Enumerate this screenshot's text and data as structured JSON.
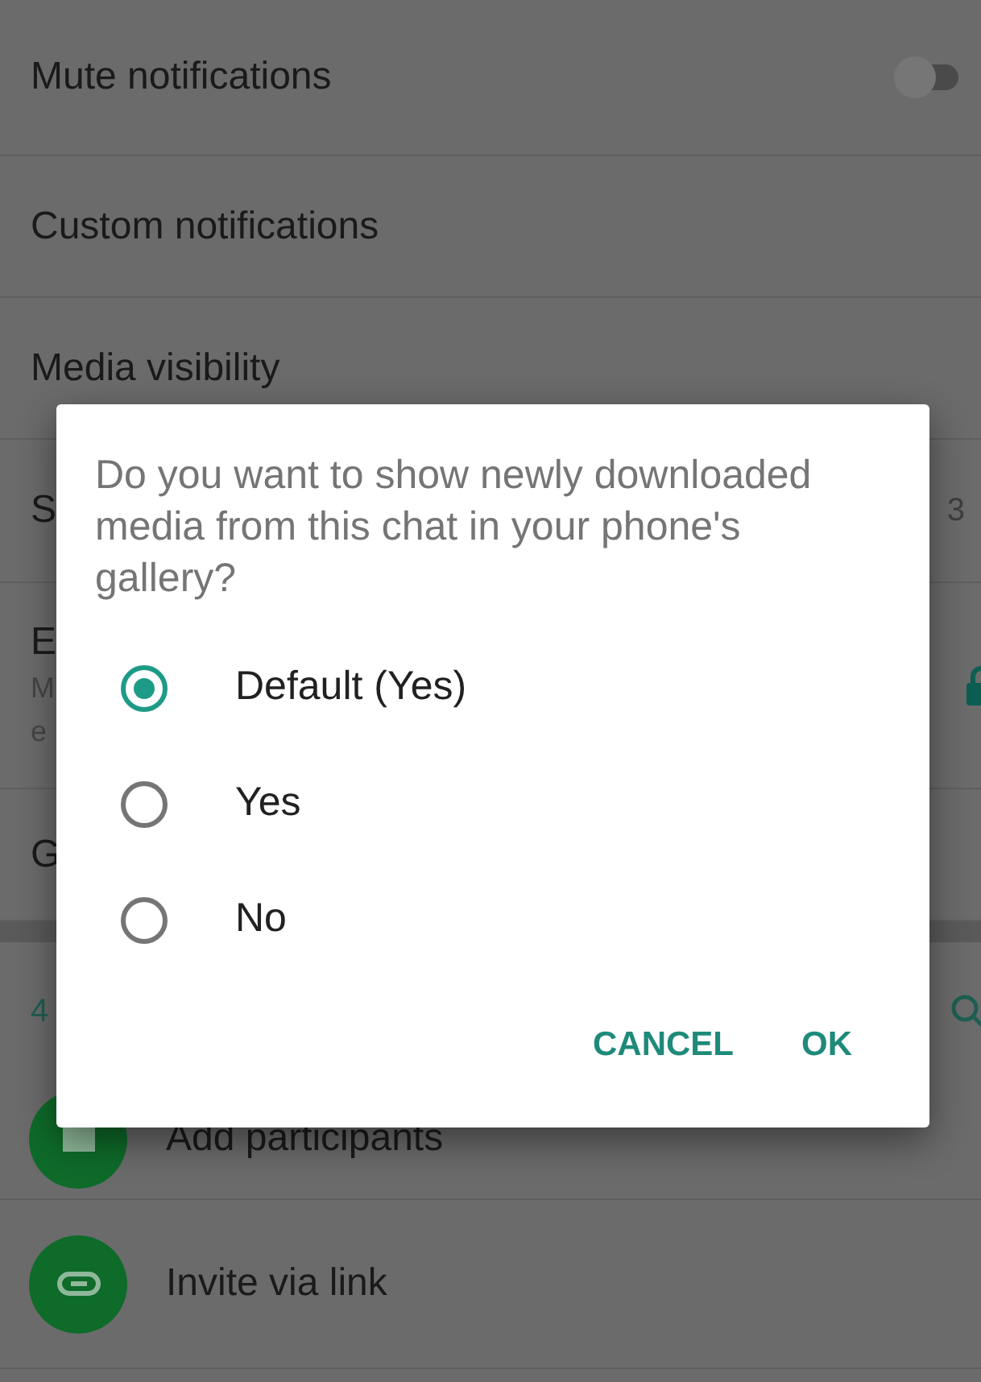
{
  "settings": [
    {
      "kind": "toggle",
      "label": "Mute notifications",
      "on": false
    },
    {
      "kind": "plain",
      "label": "Custom notifications"
    },
    {
      "kind": "plain",
      "label": "Media visibility"
    },
    {
      "kind": "plain",
      "label": "S",
      "value": "3"
    },
    {
      "kind": "lock",
      "label": "E",
      "subtitle_lines": [
        "M",
        "e"
      ]
    },
    {
      "kind": "plain",
      "label": "G"
    }
  ],
  "participants_header": {
    "count": "4"
  },
  "participant_actions": [
    {
      "kind": "add",
      "label": "Add participants"
    },
    {
      "kind": "link",
      "label": "Invite via link"
    }
  ],
  "dialog": {
    "message": "Do you want to show newly downloaded media from this chat in your phone's gallery?",
    "options": [
      {
        "label": "Default (Yes)",
        "selected": true
      },
      {
        "label": "Yes",
        "selected": false
      },
      {
        "label": "No",
        "selected": false
      }
    ],
    "buttons": [
      "CANCEL",
      "OK"
    ]
  }
}
